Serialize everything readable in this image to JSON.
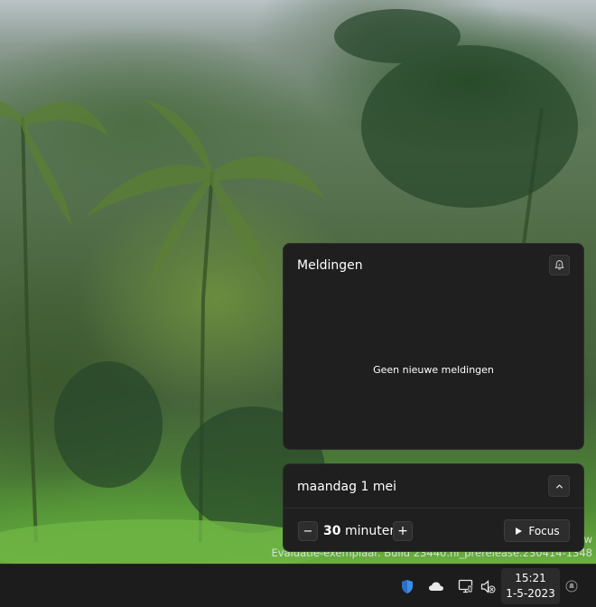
{
  "watermark": {
    "line1": "w",
    "line2": "Evaluatie-exemplaar. Build 23440.ni_prerelease.230414-1348"
  },
  "notifications": {
    "title": "Meldingen",
    "empty_message": "Geen nieuwe meldingen",
    "dnd_icon": "do-not-disturb-bell-icon"
  },
  "calendar": {
    "date_label": "maandag 1 mei",
    "collapse_icon": "chevron-up-icon"
  },
  "focus": {
    "minus_label": "−",
    "plus_label": "+",
    "duration_value": "30",
    "duration_unit": "minuten",
    "start_label": "Focus",
    "start_icon": "play-icon"
  },
  "taskbar": {
    "tray_icons": [
      "security-shield-icon",
      "onedrive-cloud-icon",
      "network-icon",
      "volume-muted-icon"
    ],
    "time": "15:21",
    "date": "1-5-2023",
    "notification_badge": "notification-badge-icon"
  },
  "colors": {
    "panel_bg": "#1f1f1f",
    "taskbar_bg": "#1c1c1c",
    "shield_blue": "#3b8ee8"
  }
}
